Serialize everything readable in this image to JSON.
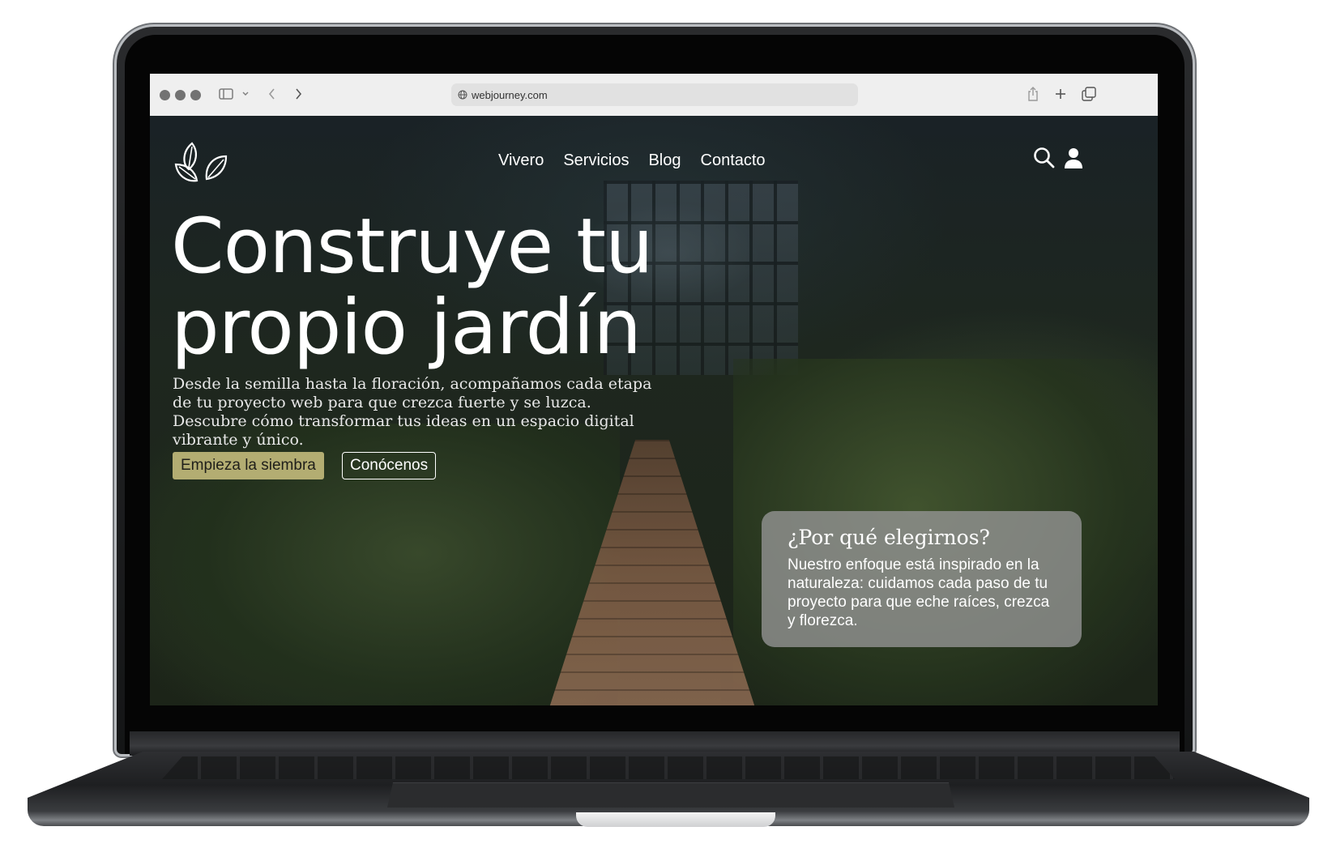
{
  "browser": {
    "url": "webjourney.com"
  },
  "site": {
    "nav": [
      "Vivero",
      "Servicios",
      "Blog",
      "Contacto"
    ],
    "hero_title": "Construye tu propio jardín",
    "hero_subtitle": "Desde la semilla hasta la floración, acompañamos cada etapa de tu proyecto web para que crezca fuerte y se luzca. Descubre cómo transformar tus ideas en un espacio digital vibrante y único.",
    "primary_button": "Empieza la siembra",
    "secondary_button": "Conócenos",
    "why": {
      "title": "¿Por qué elegirnos?",
      "text": "Nuestro enfoque está inspirado en la naturaleza: cuidamos cada paso de tu proyecto para que eche raíces, crezca y florezca."
    }
  },
  "colors": {
    "primary_button_bg": "#b3ad72",
    "card_bg": "rgba(150,150,150,.78)"
  },
  "icons": [
    "leaves-logo-icon",
    "search-icon",
    "user-icon",
    "globe-icon",
    "sidebar-icon",
    "chevron-down-icon",
    "back-icon",
    "forward-icon",
    "share-icon",
    "plus-icon",
    "tabs-icon"
  ]
}
